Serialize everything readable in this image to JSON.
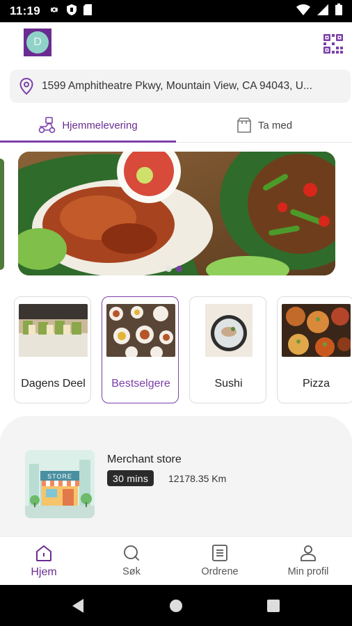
{
  "status_bar": {
    "time": "11:19",
    "left_icons": [
      "gear-icon",
      "shield-icon",
      "sim-card-icon"
    ],
    "right_icons": [
      "wifi-icon",
      "cellular-icon",
      "battery-icon"
    ]
  },
  "header": {
    "avatar_letter": "D",
    "qr_icon": "qr-code-icon",
    "brand_color": "#6a2c91"
  },
  "address": {
    "icon": "location-pin-icon",
    "text": "1599 Amphitheatre Pkwy, Mountain View, CA 94043, U..."
  },
  "tabs": [
    {
      "label": "Hjemmelevering",
      "icon": "delivery-scooter-icon",
      "active": true
    },
    {
      "label": "Ta med",
      "icon": "takeaway-bag-icon",
      "active": false
    }
  ],
  "banner": {
    "slides": 2,
    "active_slide": 2
  },
  "categories": [
    {
      "label": "Dagens Deel",
      "active": false
    },
    {
      "label": "Bestselgere",
      "active": true
    },
    {
      "label": "Sushi",
      "active": false
    },
    {
      "label": "Pizza",
      "active": false
    }
  ],
  "store": {
    "name": "Merchant store",
    "time": "30 mins",
    "distance": "12178.35 Km",
    "thumb_sign": "STORE"
  },
  "bottom_nav": [
    {
      "label": "Hjem",
      "icon": "home-icon",
      "active": true
    },
    {
      "label": "Søk",
      "icon": "search-icon",
      "active": false
    },
    {
      "label": "Ordrene",
      "icon": "orders-list-icon",
      "active": false
    },
    {
      "label": "Min profil",
      "icon": "profile-icon",
      "active": false
    }
  ],
  "colors": {
    "accent": "#7b3fa8",
    "status_bar": "#000000",
    "time_badge": "#2b2b2b"
  }
}
